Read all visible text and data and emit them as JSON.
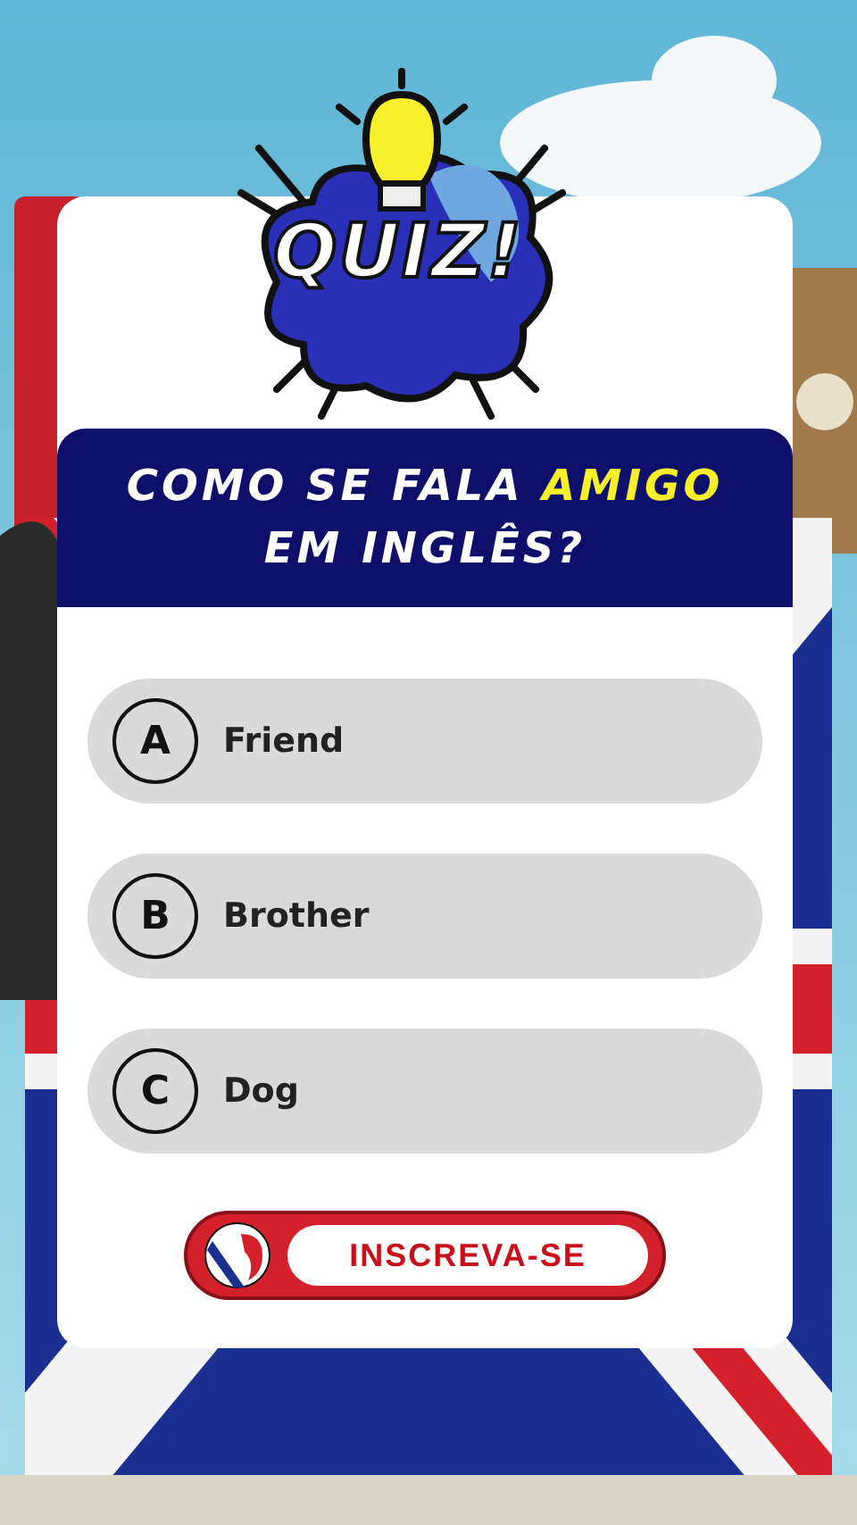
{
  "logo": {
    "text": "QUIZ!"
  },
  "question": {
    "before": "COMO SE FALA",
    "highlight": "AMIGO",
    "after": "EM INGLÊS?"
  },
  "options": [
    {
      "letter": "A",
      "text": "Friend"
    },
    {
      "letter": "B",
      "text": "Brother"
    },
    {
      "letter": "C",
      "text": "Dog"
    }
  ],
  "subscribe": {
    "label": "INSCREVA-SE"
  }
}
